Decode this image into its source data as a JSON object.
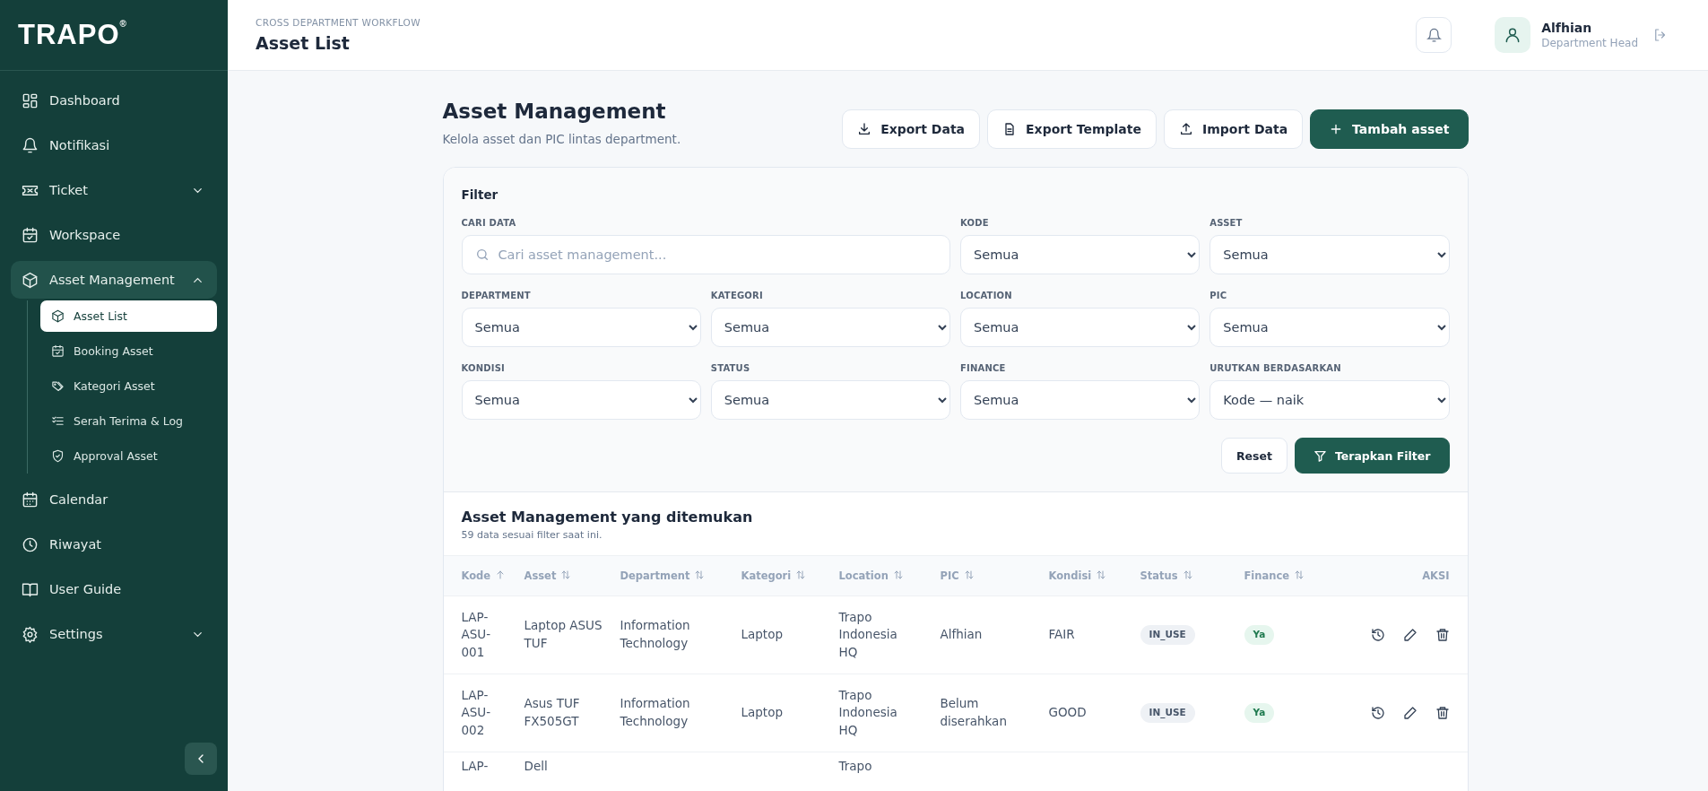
{
  "sidebar": {
    "logo": "TRAPO",
    "logo_mark": "®",
    "items": [
      {
        "label": "Dashboard",
        "kind": "link",
        "selected": false
      },
      {
        "label": "Notifikasi",
        "kind": "link",
        "selected": false
      },
      {
        "label": "Ticket",
        "kind": "group",
        "expanded": false,
        "selected": false
      },
      {
        "label": "Workspace",
        "kind": "link",
        "selected": false
      },
      {
        "label": "Asset Management",
        "kind": "group",
        "expanded": true,
        "selected": true,
        "children": [
          {
            "label": "Asset List",
            "selected": true
          },
          {
            "label": "Booking Asset",
            "selected": false
          },
          {
            "label": "Kategori Asset",
            "selected": false
          },
          {
            "label": "Serah Terima & Log",
            "selected": false
          },
          {
            "label": "Approval Asset",
            "selected": false
          }
        ]
      },
      {
        "label": "Calendar",
        "kind": "link",
        "selected": false
      },
      {
        "label": "Riwayat",
        "kind": "link",
        "selected": false
      },
      {
        "label": "User Guide",
        "kind": "link",
        "selected": false
      },
      {
        "label": "Settings",
        "kind": "group",
        "expanded": false,
        "selected": false
      }
    ]
  },
  "header": {
    "breadcrumb": "CROSS DEPARTMENT WORKFLOW",
    "title": "Asset List",
    "user": {
      "name": "Alfhian",
      "role": "Department Head"
    }
  },
  "page": {
    "title": "Asset Management",
    "subtitle": "Kelola asset dan PIC lintas department.",
    "actions": [
      {
        "label": "Export Data",
        "kind": "outline"
      },
      {
        "label": "Export Template",
        "kind": "outline"
      },
      {
        "label": "Import Data",
        "kind": "outline"
      },
      {
        "label": "Tambah asset",
        "kind": "primary"
      }
    ]
  },
  "filter": {
    "title": "Filter",
    "fields": [
      {
        "label": "CARI DATA",
        "kind": "search",
        "placeholder": "Cari asset management..."
      },
      {
        "label": "KODE",
        "kind": "select",
        "value": "Semua"
      },
      {
        "label": "ASSET",
        "kind": "select",
        "value": "Semua"
      },
      {
        "label": "DEPARTMENT",
        "kind": "select",
        "value": "Semua"
      },
      {
        "label": "KATEGORI",
        "kind": "select",
        "value": "Semua"
      },
      {
        "label": "LOCATION",
        "kind": "select",
        "value": "Semua"
      },
      {
        "label": "PIC",
        "kind": "select",
        "value": "Semua"
      },
      {
        "label": "KONDISI",
        "kind": "select",
        "value": "Semua"
      },
      {
        "label": "STATUS",
        "kind": "select",
        "value": "Semua"
      },
      {
        "label": "FINANCE",
        "kind": "select",
        "value": "Semua"
      },
      {
        "label": "URUTKAN BERDASARKAN",
        "kind": "select",
        "value": "Kode — naik"
      }
    ],
    "buttons": [
      {
        "label": "Reset",
        "kind": "outline"
      },
      {
        "label": "Terapkan Filter",
        "kind": "primary"
      }
    ]
  },
  "results": {
    "title": "Asset Management yang ditemukan",
    "count_text": "59 data sesuai filter saat ini.",
    "columns": [
      {
        "label": "Kode",
        "kind": "sorted"
      },
      {
        "label": "Asset",
        "kind": "sortable"
      },
      {
        "label": "Department",
        "kind": "sortable"
      },
      {
        "label": "Kategori",
        "kind": "sortable"
      },
      {
        "label": "Location",
        "kind": "sortable"
      },
      {
        "label": "PIC",
        "kind": "sortable"
      },
      {
        "label": "Kondisi",
        "kind": "sortable"
      },
      {
        "label": "Status",
        "kind": "sortable"
      },
      {
        "label": "Finance",
        "kind": "sortable"
      },
      {
        "label": "AKSI",
        "kind": "plain"
      }
    ],
    "rows": [
      {
        "kode": "LAP-ASU-001",
        "asset": "Laptop ASUS TUF",
        "department": "Information Technology",
        "kategori": "Laptop",
        "location": "Trapo Indonesia HQ",
        "pic": "Alfhian",
        "kondisi": "FAIR",
        "status": "IN_USE",
        "finance": "Ya",
        "actions": true
      },
      {
        "kode": "LAP-ASU-002",
        "asset": "Asus TUF FX505GT",
        "department": "Information Technology",
        "kategori": "Laptop",
        "location": "Trapo Indonesia HQ",
        "pic": "Belum diserahkan",
        "kondisi": "GOOD",
        "status": "IN_USE",
        "finance": "Ya",
        "actions": true
      },
      {
        "kode": "LAP-",
        "asset": "Dell",
        "location": "Trapo",
        "actions": false
      }
    ]
  }
}
